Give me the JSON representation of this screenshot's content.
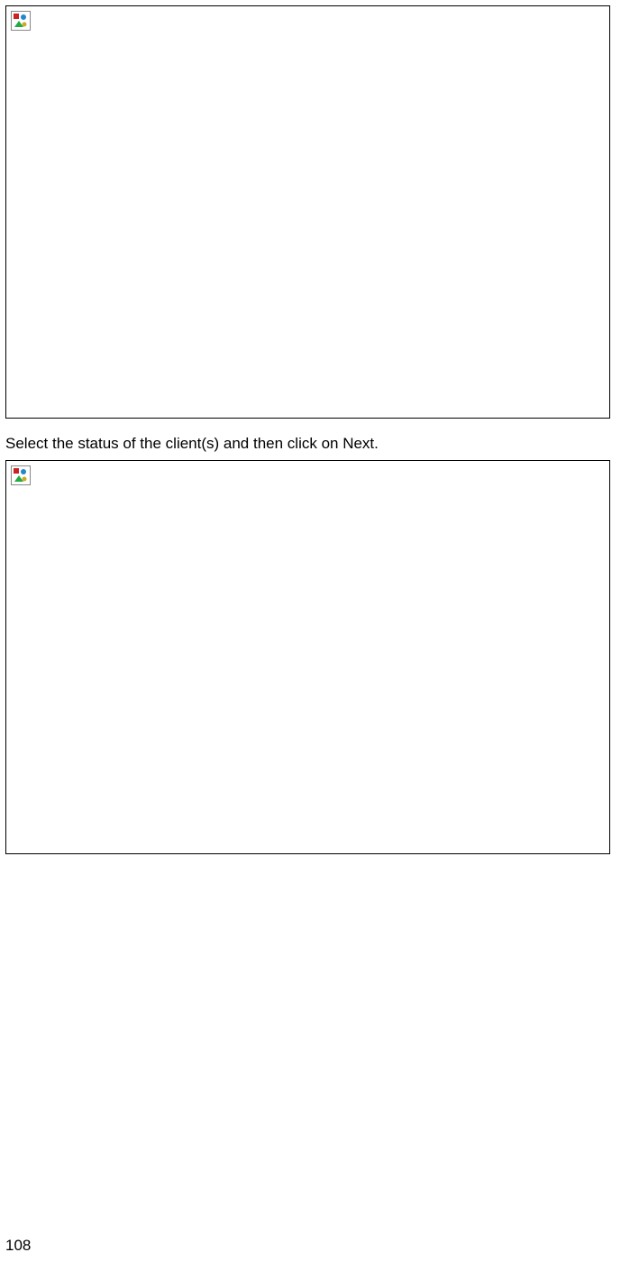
{
  "instruction": "Select the status of the client(s) and then click on Next.",
  "page_number": "108",
  "icons": {
    "broken_image_1": "broken-image-icon",
    "broken_image_2": "broken-image-icon"
  }
}
